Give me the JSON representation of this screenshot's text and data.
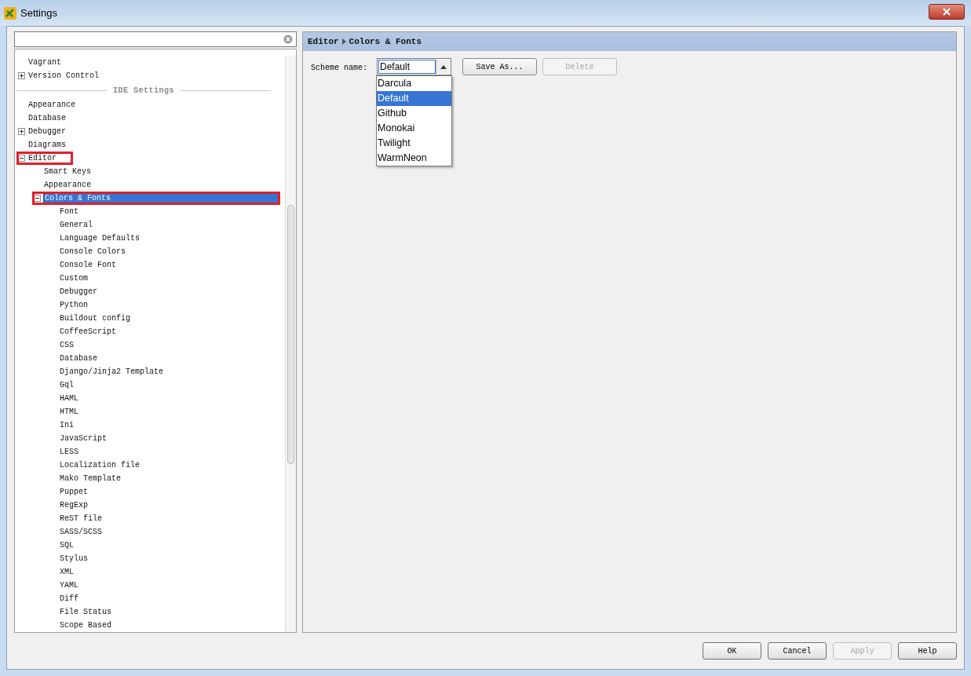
{
  "window": {
    "title": "Settings"
  },
  "tree": [
    {
      "label": "Vagrant",
      "kind": "item",
      "selected": false
    },
    {
      "label": "Version Control",
      "kind": "item",
      "selected": false,
      "expanded": false
    },
    {
      "label": "IDE Settings",
      "kind": "section"
    },
    {
      "label": "Appearance",
      "kind": "item",
      "selected": false
    },
    {
      "label": "Database",
      "kind": "item",
      "selected": false
    },
    {
      "label": "Debugger",
      "kind": "item",
      "selected": false,
      "expanded": false
    },
    {
      "label": "Diagrams",
      "kind": "item",
      "selected": false
    },
    {
      "label": "Editor",
      "kind": "item",
      "selected": false,
      "expanded": true,
      "highlighted": true,
      "children": [
        {
          "label": "Smart Keys",
          "selected": false
        },
        {
          "label": "Appearance",
          "selected": false
        },
        {
          "label": "Colors & Fonts",
          "expanded": true,
          "selected": true,
          "highlighted": true,
          "children": [
            {
              "label": "Font",
              "selected": false
            },
            {
              "label": "General",
              "selected": false
            },
            {
              "label": "Language Defaults",
              "selected": false
            },
            {
              "label": "Console Colors",
              "selected": false
            },
            {
              "label": "Console Font",
              "selected": false
            },
            {
              "label": "Custom",
              "selected": false
            },
            {
              "label": "Debugger",
              "selected": false
            },
            {
              "label": "Python",
              "selected": false
            },
            {
              "label": "Buildout config",
              "selected": false
            },
            {
              "label": "CoffeeScript",
              "selected": false
            },
            {
              "label": "CSS",
              "selected": false
            },
            {
              "label": "Database",
              "selected": false
            },
            {
              "label": "Django/Jinja2 Template",
              "selected": false
            },
            {
              "label": "Gql",
              "selected": false
            },
            {
              "label": "HAML",
              "selected": false
            },
            {
              "label": "HTML",
              "selected": false
            },
            {
              "label": "Ini",
              "selected": false
            },
            {
              "label": "JavaScript",
              "selected": false
            },
            {
              "label": "LESS",
              "selected": false
            },
            {
              "label": "Localization file",
              "selected": false
            },
            {
              "label": "Mako Template",
              "selected": false
            },
            {
              "label": "Puppet",
              "selected": false
            },
            {
              "label": "RegExp",
              "selected": false
            },
            {
              "label": "ReST file",
              "selected": false
            },
            {
              "label": "SASS/SCSS",
              "selected": false
            },
            {
              "label": "SQL",
              "selected": false
            },
            {
              "label": "Stylus",
              "selected": false
            },
            {
              "label": "XML",
              "selected": false
            },
            {
              "label": "YAML",
              "selected": false
            },
            {
              "label": "Diff",
              "selected": false
            },
            {
              "label": "File Status",
              "selected": false
            },
            {
              "label": "Scope Based",
              "selected": false
            }
          ]
        }
      ]
    }
  ],
  "breadcrumb": [
    "Editor",
    "Colors & Fonts"
  ],
  "scheme": {
    "label": "Scheme name:",
    "value": "Default",
    "expanded": true,
    "options": [
      {
        "label": "Darcula",
        "selected": false
      },
      {
        "label": "Default",
        "selected": true
      },
      {
        "label": "Github",
        "selected": false
      },
      {
        "label": "Monokai",
        "selected": false
      },
      {
        "label": "Twilight",
        "selected": false
      },
      {
        "label": "WarmNeon",
        "selected": false
      }
    ]
  },
  "scheme_buttons": [
    {
      "label": "Save As...",
      "disabled": false
    },
    {
      "label": "Delete",
      "disabled": true
    }
  ],
  "buttons": [
    {
      "label": "OK",
      "disabled": false
    },
    {
      "label": "Cancel",
      "disabled": false
    },
    {
      "label": "Apply",
      "disabled": true
    },
    {
      "label": "Help",
      "disabled": false
    }
  ]
}
